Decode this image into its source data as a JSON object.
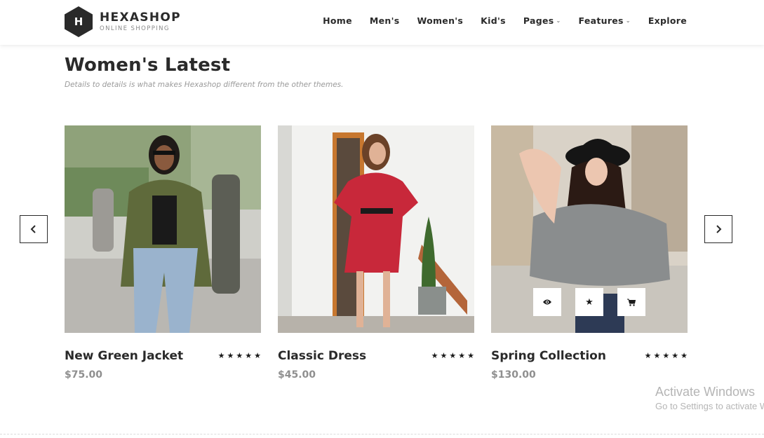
{
  "brand": {
    "logo_letter": "H",
    "name": "HEXASHOP",
    "tagline": "ONLINE SHOPPING",
    "color": "#2a2a2a"
  },
  "nav": {
    "items": [
      {
        "label": "Home",
        "has_dropdown": false
      },
      {
        "label": "Men's",
        "has_dropdown": false
      },
      {
        "label": "Women's",
        "has_dropdown": false
      },
      {
        "label": "Kid's",
        "has_dropdown": false
      },
      {
        "label": "Pages",
        "has_dropdown": true
      },
      {
        "label": "Features",
        "has_dropdown": true
      },
      {
        "label": "Explore",
        "has_dropdown": false
      }
    ],
    "dropdown_icon": "chevron-down-icon"
  },
  "section": {
    "title": "Women's Latest",
    "description": "Details to details is what makes Hexashop different from the other themes."
  },
  "carousel": {
    "prev_icon": "chevron-left-icon",
    "next_icon": "chevron-right-icon"
  },
  "products": [
    {
      "name": "New Green Jacket",
      "price": "$75.00",
      "rating": 5,
      "image": "woman-green-jacket-photo"
    },
    {
      "name": "Classic Dress",
      "price": "$45.00",
      "rating": 5,
      "image": "woman-red-floral-dress-photo"
    },
    {
      "name": "Spring Collection",
      "price": "$130.00",
      "rating": 5,
      "image": "woman-grey-poncho-hat-photo",
      "hover_actions": [
        "eye-icon",
        "star-icon",
        "cart-icon"
      ]
    }
  ],
  "watermark": {
    "title": "Activate Windows",
    "subtitle": "Go to Settings to activate Windows."
  }
}
